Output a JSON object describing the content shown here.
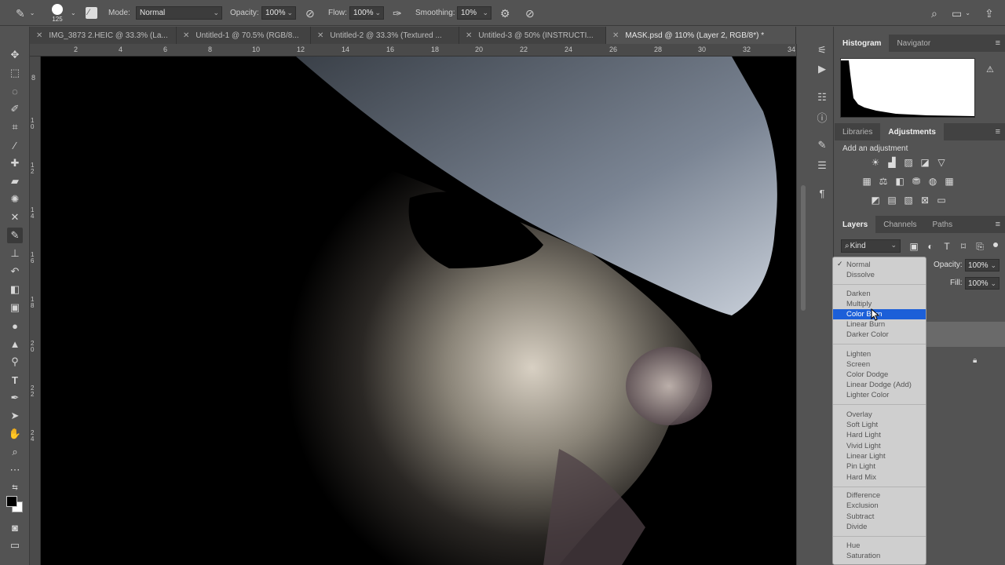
{
  "options_bar": {
    "brush_size": "125",
    "mode_label": "Mode:",
    "mode_value": "Normal",
    "opacity_label": "Opacity:",
    "opacity_value": "100%",
    "flow_label": "Flow:",
    "flow_value": "100%",
    "smoothing_label": "Smoothing:",
    "smoothing_value": "10%"
  },
  "tabs": [
    {
      "label": "IMG_3873 2.HEIC @ 33.3% (La..."
    },
    {
      "label": "Untitled-1 @ 70.5% (RGB/8..."
    },
    {
      "label": "Untitled-2 @ 33.3% (Textured ..."
    },
    {
      "label": "Untitled-3 @ 50% (INSTRUCTI..."
    },
    {
      "label": "MASK.psd @ 110% (Layer 2, RGB/8*) *"
    }
  ],
  "ruler": {
    "h_ticks": [
      "2",
      "4",
      "6",
      "8",
      "10",
      "12",
      "14",
      "16",
      "18",
      "20",
      "22",
      "24",
      "26",
      "28",
      "30",
      "32",
      "34"
    ],
    "v_ticks": [
      "8",
      "1 0",
      "1 2",
      "1 4",
      "1 6",
      "1 8",
      "2 0",
      "2 2",
      "2 4"
    ]
  },
  "histogram_panel": {
    "tabs": [
      "Histogram",
      "Navigator"
    ]
  },
  "adjustments_panel": {
    "tabs": [
      "Libraries",
      "Adjustments"
    ],
    "title": "Add an adjustment"
  },
  "layers_panel": {
    "tabs": [
      "Layers",
      "Channels",
      "Paths"
    ],
    "filter_kind": "Kind",
    "opacity_label": "Opacity:",
    "opacity_value": "100%",
    "fill_label": "Fill:",
    "fill_value": "100%"
  },
  "blend_modes": {
    "groups": [
      [
        "Normal",
        "Dissolve"
      ],
      [
        "Darken",
        "Multiply",
        "Color Burn",
        "Linear Burn",
        "Darker Color"
      ],
      [
        "Lighten",
        "Screen",
        "Color Dodge",
        "Linear Dodge (Add)",
        "Lighter Color"
      ],
      [
        "Overlay",
        "Soft Light",
        "Hard Light",
        "Vivid Light",
        "Linear Light",
        "Pin Light",
        "Hard Mix"
      ],
      [
        "Difference",
        "Exclusion",
        "Subtract",
        "Divide"
      ],
      [
        "Hue",
        "Saturation"
      ]
    ],
    "checked": "Normal",
    "highlighted": "Color Burn"
  },
  "colors": {
    "accent": "#1c5fd8",
    "ui_bg": "#535353",
    "panel_tab_bg": "#424242"
  }
}
